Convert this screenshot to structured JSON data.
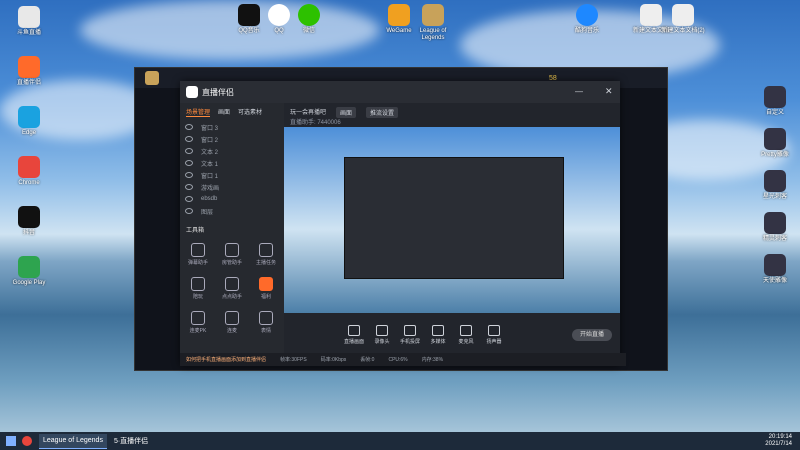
{
  "desktop": {
    "icons": [
      {
        "label": "斗鱼直播",
        "color": "#e8e8e8"
      },
      {
        "label": "QQ音乐",
        "color": "#222"
      },
      {
        "label": "QQ",
        "color": "#ffffff"
      },
      {
        "label": "微信",
        "color": "#2dc100"
      },
      {
        "label": "WeGame",
        "color": "#f0a020"
      },
      {
        "label": "League of Legends",
        "color": "#c8a25a"
      },
      {
        "label": "酷狗音乐",
        "color": "#1e88ff"
      },
      {
        "label": "新建文本文档",
        "color": "#eeeeee"
      },
      {
        "label": "新建文本文档(2)",
        "color": "#eeeeee"
      },
      {
        "label": "直播伴侣",
        "color": "#ff6a2a"
      },
      {
        "label": "Edge",
        "color": "#1aa2e0"
      },
      {
        "label": "Chrome",
        "color": "#e8453c"
      },
      {
        "label": "抖音",
        "color": "#111"
      },
      {
        "label": "Google Play",
        "color": "#2ea44f"
      }
    ],
    "right_icons": [
      {
        "label": "自定义"
      },
      {
        "label": "Pretty雕像"
      },
      {
        "label": "星光刺客"
      },
      {
        "label": "精灵刺客"
      },
      {
        "label": "天使雕像"
      }
    ]
  },
  "game_window": {
    "title": "League of Legends",
    "score": "58"
  },
  "main_window": {
    "app_name": "直播伴侣",
    "tabs": [
      "场景管理",
      "画面",
      "可选素材"
    ],
    "layers": [
      "窗口 3",
      "窗口 2",
      "文本 2",
      "文本 1",
      "窗口 1",
      "游戏画",
      "ebsdb",
      "图层"
    ],
    "tools_title": "工具箱",
    "tools": [
      "弹幕助手",
      "房管助手",
      "主播任务",
      "陪玩",
      "点点助手",
      "福利",
      "连麦PK",
      "连麦",
      "表情"
    ],
    "right_tabs": [
      "玩一会再播吧",
      "画面",
      "推流设置"
    ],
    "status": "直播助手: 7440006",
    "controls": [
      "直播画面",
      "录像头",
      "手机投屏",
      "多媒体",
      "麦克风",
      "扬声器"
    ],
    "start_button": "开始直播",
    "bottom_status": [
      "帧率:30FPS",
      "码率:0Kbps",
      "丢帧:0",
      "CPU:6%",
      "内存:38%"
    ],
    "tip": "如何把手机直播画面添加到直播伴侣"
  },
  "taskbar": {
    "items": [
      {
        "label": "League of Legends"
      },
      {
        "label": "5·直播伴侣"
      }
    ],
    "time": "20:19:14",
    "date": "2021/7/14"
  }
}
